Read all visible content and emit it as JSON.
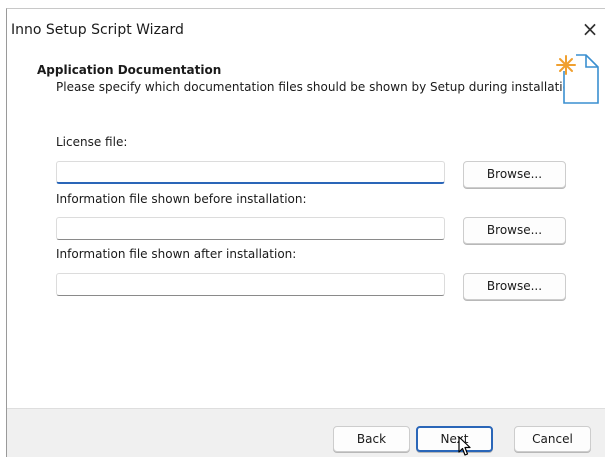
{
  "window": {
    "title": "Inno Setup Script Wizard",
    "close_glyph": "×"
  },
  "header": {
    "title": "Application Documentation",
    "subtitle": "Please specify which documentation files should be shown by Setup during installation.",
    "icon": "wizard-document-sparkle-icon",
    "accent_color": "#f0a030"
  },
  "fields": [
    {
      "label": "License file:",
      "value": "",
      "browse_label": "Browse...",
      "focused": true
    },
    {
      "label": "Information file shown before installation:",
      "value": "",
      "browse_label": "Browse..."
    },
    {
      "label": "Information file shown after installation:",
      "value": "",
      "browse_label": "Browse..."
    }
  ],
  "footer": {
    "back_label": "Back",
    "next_label": "Next",
    "cancel_label": "Cancel"
  },
  "colors": {
    "focus_accent": "#2a66b8",
    "footer_bg": "#f0f0f0"
  }
}
